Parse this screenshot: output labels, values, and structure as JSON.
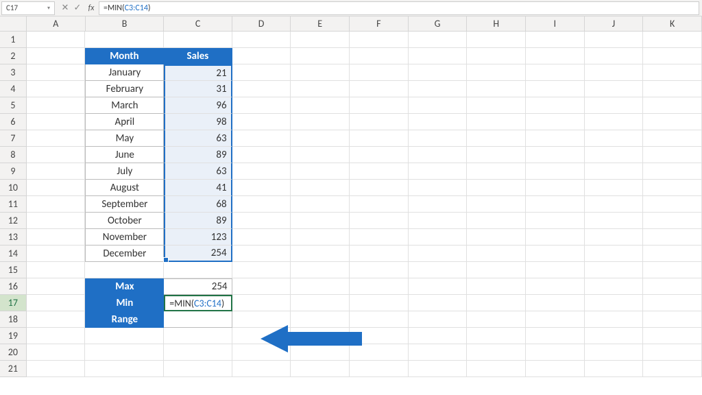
{
  "nameBox": "C17",
  "formula": {
    "prefix": "=MIN(",
    "ref": "C3:C14",
    "suffix": ")"
  },
  "cols": [
    "A",
    "B",
    "C",
    "D",
    "E",
    "F",
    "G",
    "H",
    "I",
    "J",
    "K"
  ],
  "rows": [
    "1",
    "2",
    "3",
    "4",
    "5",
    "6",
    "7",
    "8",
    "9",
    "10",
    "11",
    "12",
    "13",
    "14",
    "15",
    "16",
    "17",
    "18",
    "19",
    "20",
    "21"
  ],
  "activeRow": "17",
  "headers": {
    "month": "Month",
    "sales": "Sales"
  },
  "table": [
    {
      "month": "January",
      "sales": "21"
    },
    {
      "month": "February",
      "sales": "31"
    },
    {
      "month": "March",
      "sales": "96"
    },
    {
      "month": "April",
      "sales": "98"
    },
    {
      "month": "May",
      "sales": "63"
    },
    {
      "month": "June",
      "sales": "89"
    },
    {
      "month": "July",
      "sales": "63"
    },
    {
      "month": "August",
      "sales": "41"
    },
    {
      "month": "September",
      "sales": "68"
    },
    {
      "month": "October",
      "sales": "89"
    },
    {
      "month": "November",
      "sales": "123"
    },
    {
      "month": "December",
      "sales": "254"
    }
  ],
  "summary": {
    "maxLabel": "Max",
    "maxVal": "254",
    "minLabel": "Min",
    "rangeLabel": "Range",
    "rangeVal": ""
  },
  "editing": {
    "prefix": "=MIN(",
    "ref": "C3:C14",
    "suffix": ")"
  },
  "colors": {
    "accent": "#1f6fc5",
    "selection": "#217346"
  }
}
